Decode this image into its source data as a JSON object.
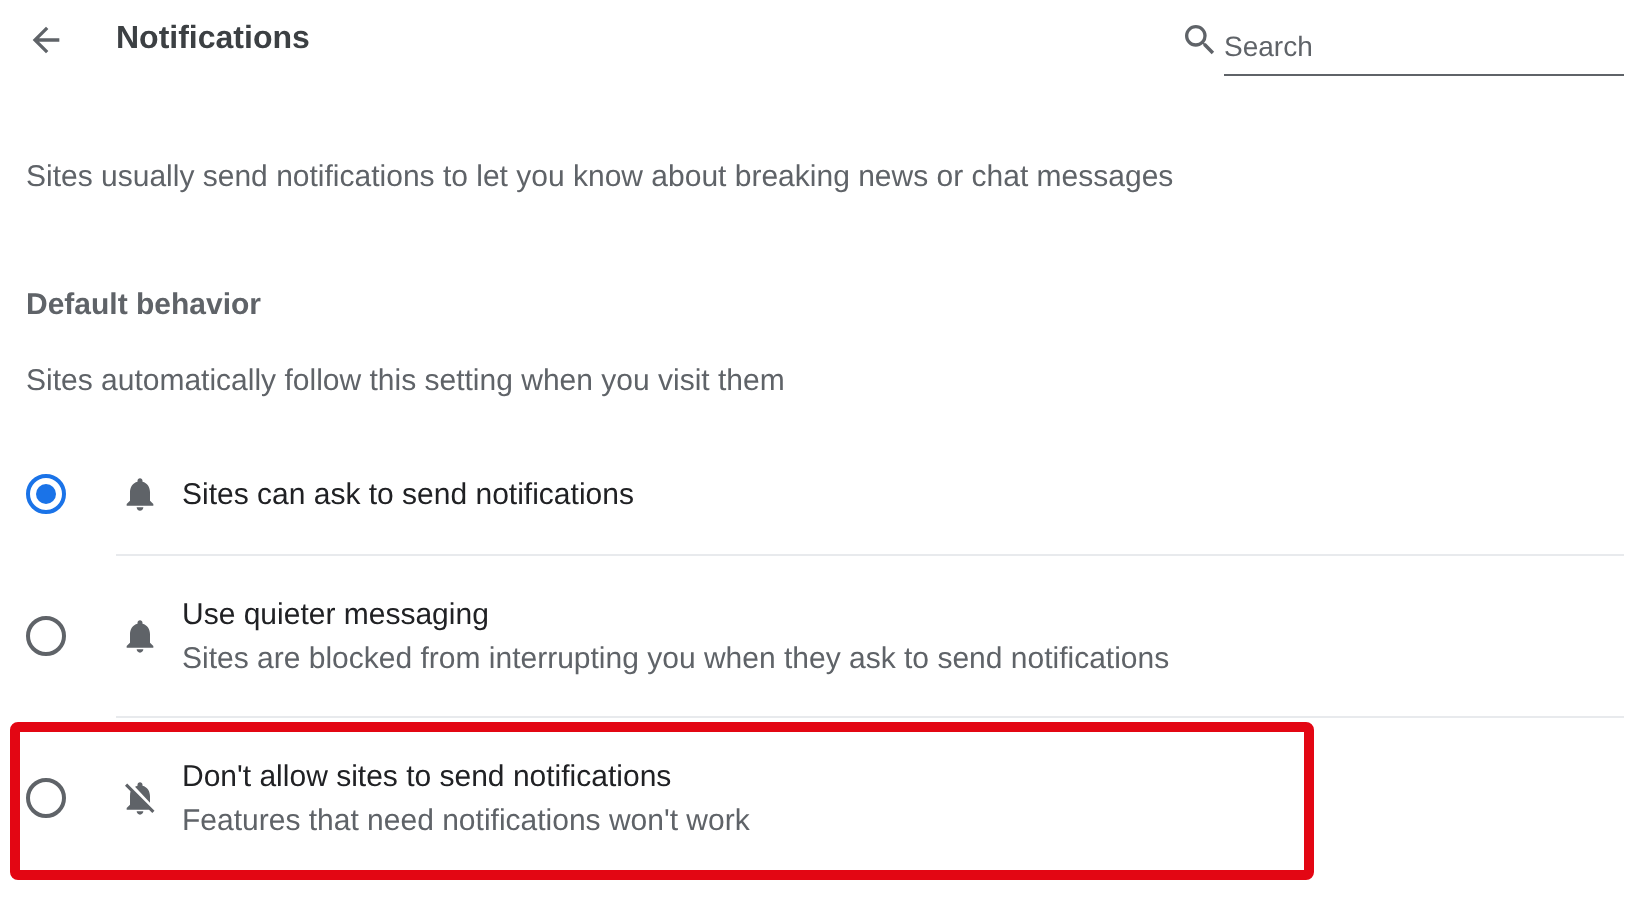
{
  "header": {
    "title": "Notifications",
    "search": {
      "placeholder": "Search"
    }
  },
  "description": "Sites usually send notifications to let you know about breaking news or chat messages",
  "default_behavior": {
    "heading": "Default behavior",
    "subtitle": "Sites automatically follow this setting when you visit them"
  },
  "options": [
    {
      "kind": "allow",
      "label": "Sites can ask to send notifications",
      "selected": true,
      "highlighted": false
    },
    {
      "kind": "allow",
      "label": "Use quieter messaging",
      "sublabel": "Sites are blocked from interrupting you when they ask to send notifications",
      "selected": false,
      "highlighted": false
    },
    {
      "kind": "block",
      "label": "Don't allow sites to send notifications",
      "sublabel": "Features that need notifications won't work",
      "selected": false,
      "highlighted": true
    }
  ]
}
